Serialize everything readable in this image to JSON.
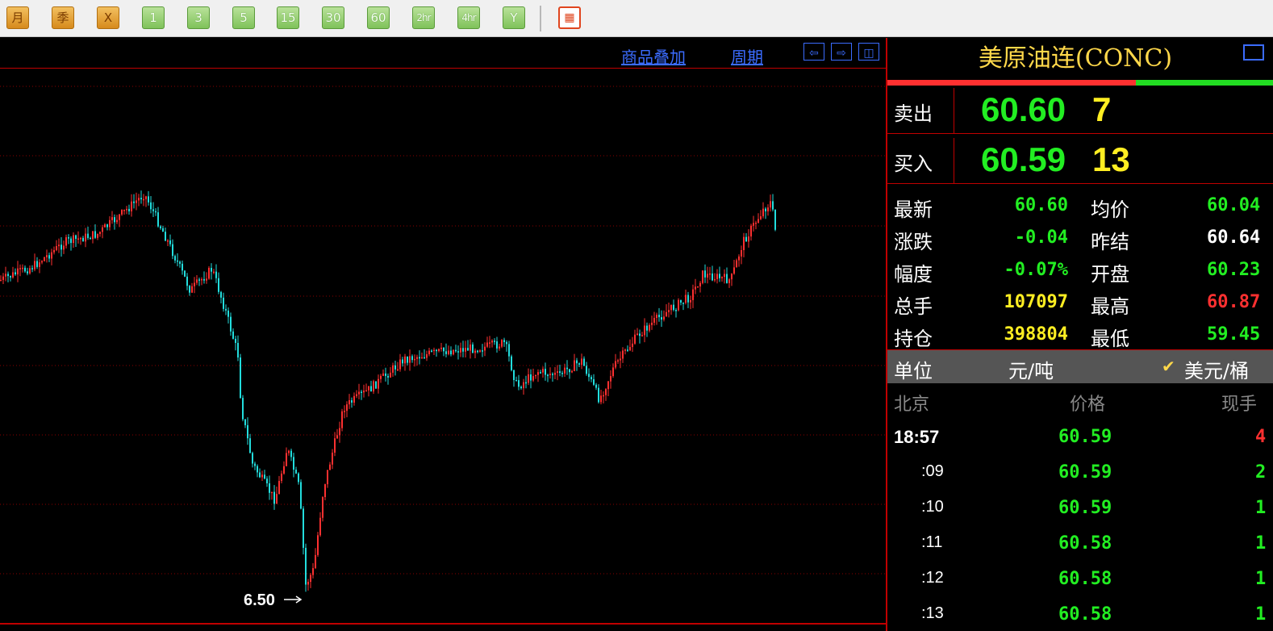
{
  "toolbar": {
    "buttons": [
      {
        "label": "月",
        "style": "orange"
      },
      {
        "label": "季",
        "style": "orange"
      },
      {
        "label": "X",
        "style": "orange"
      },
      {
        "label": "1",
        "style": "green"
      },
      {
        "label": "3",
        "style": "green"
      },
      {
        "label": "5",
        "style": "green"
      },
      {
        "label": "15",
        "style": "green"
      },
      {
        "label": "30",
        "style": "green"
      },
      {
        "label": "60",
        "style": "green"
      },
      {
        "label": "2hr",
        "style": "green"
      },
      {
        "label": "4hr",
        "style": "green"
      },
      {
        "label": "Y",
        "style": "green"
      }
    ],
    "grid_icon": "grid-table-icon"
  },
  "chart_header": {
    "overlay_link": "商品叠加",
    "period_link": "周期",
    "nav_icons": [
      "arrow-left-icon",
      "arrow-right-icon",
      "panel-toggle-icon"
    ]
  },
  "chart": {
    "low_label": "6.50"
  },
  "panel": {
    "title": "美原油连(CONC)",
    "sell": {
      "label": "卖出",
      "price": "60.60",
      "volume": "7"
    },
    "buy": {
      "label": "买入",
      "price": "60.59",
      "volume": "13"
    },
    "stats": [
      {
        "label": "最新",
        "value": "60.60",
        "color": "#22ee22",
        "label2": "均价",
        "value2": "60.04",
        "color2": "#22ee22"
      },
      {
        "label": "涨跌",
        "value": "-0.04",
        "color": "#22ee22",
        "label2": "昨结",
        "value2": "60.64",
        "color2": "#ffffff"
      },
      {
        "label": "幅度",
        "value": "-0.07%",
        "color": "#22ee22",
        "label2": "开盘",
        "value2": "60.23",
        "color2": "#22ee22"
      },
      {
        "label": "总手",
        "value": "107097",
        "color": "#ffee22",
        "label2": "最高",
        "value2": "60.87",
        "color2": "#ff3030"
      },
      {
        "label": "持仓",
        "value": "398804",
        "color": "#ffee22",
        "label2": "最低",
        "value2": "59.45",
        "color2": "#22ee22"
      }
    ],
    "unit": {
      "label": "单位",
      "option1": "元/吨",
      "option2": "美元/桶"
    },
    "tick_header": {
      "time": "北京",
      "price": "价格",
      "volume": "现手"
    },
    "ticks": [
      {
        "time": "18:57",
        "price": "60.59",
        "volume": "4",
        "vcolor": "#ff3030"
      },
      {
        "time": ":09",
        "price": "60.59",
        "volume": "2",
        "vcolor": "#22ee22"
      },
      {
        "time": ":10",
        "price": "60.59",
        "volume": "1",
        "vcolor": "#22ee22"
      },
      {
        "time": ":11",
        "price": "60.58",
        "volume": "1",
        "vcolor": "#22ee22"
      },
      {
        "time": ":12",
        "price": "60.58",
        "volume": "1",
        "vcolor": "#22ee22"
      },
      {
        "time": ":13",
        "price": "60.58",
        "volume": "1",
        "vcolor": "#22ee22"
      }
    ]
  },
  "colors": {
    "background": "#000000",
    "grid_red": "#c00000",
    "up_candle": "#ff3030",
    "down_candle": "#22dddd",
    "price_green": "#22ee22",
    "volume_yellow": "#ffee22",
    "title_gold": "#ffd84a",
    "link_blue": "#3b6cff"
  }
}
